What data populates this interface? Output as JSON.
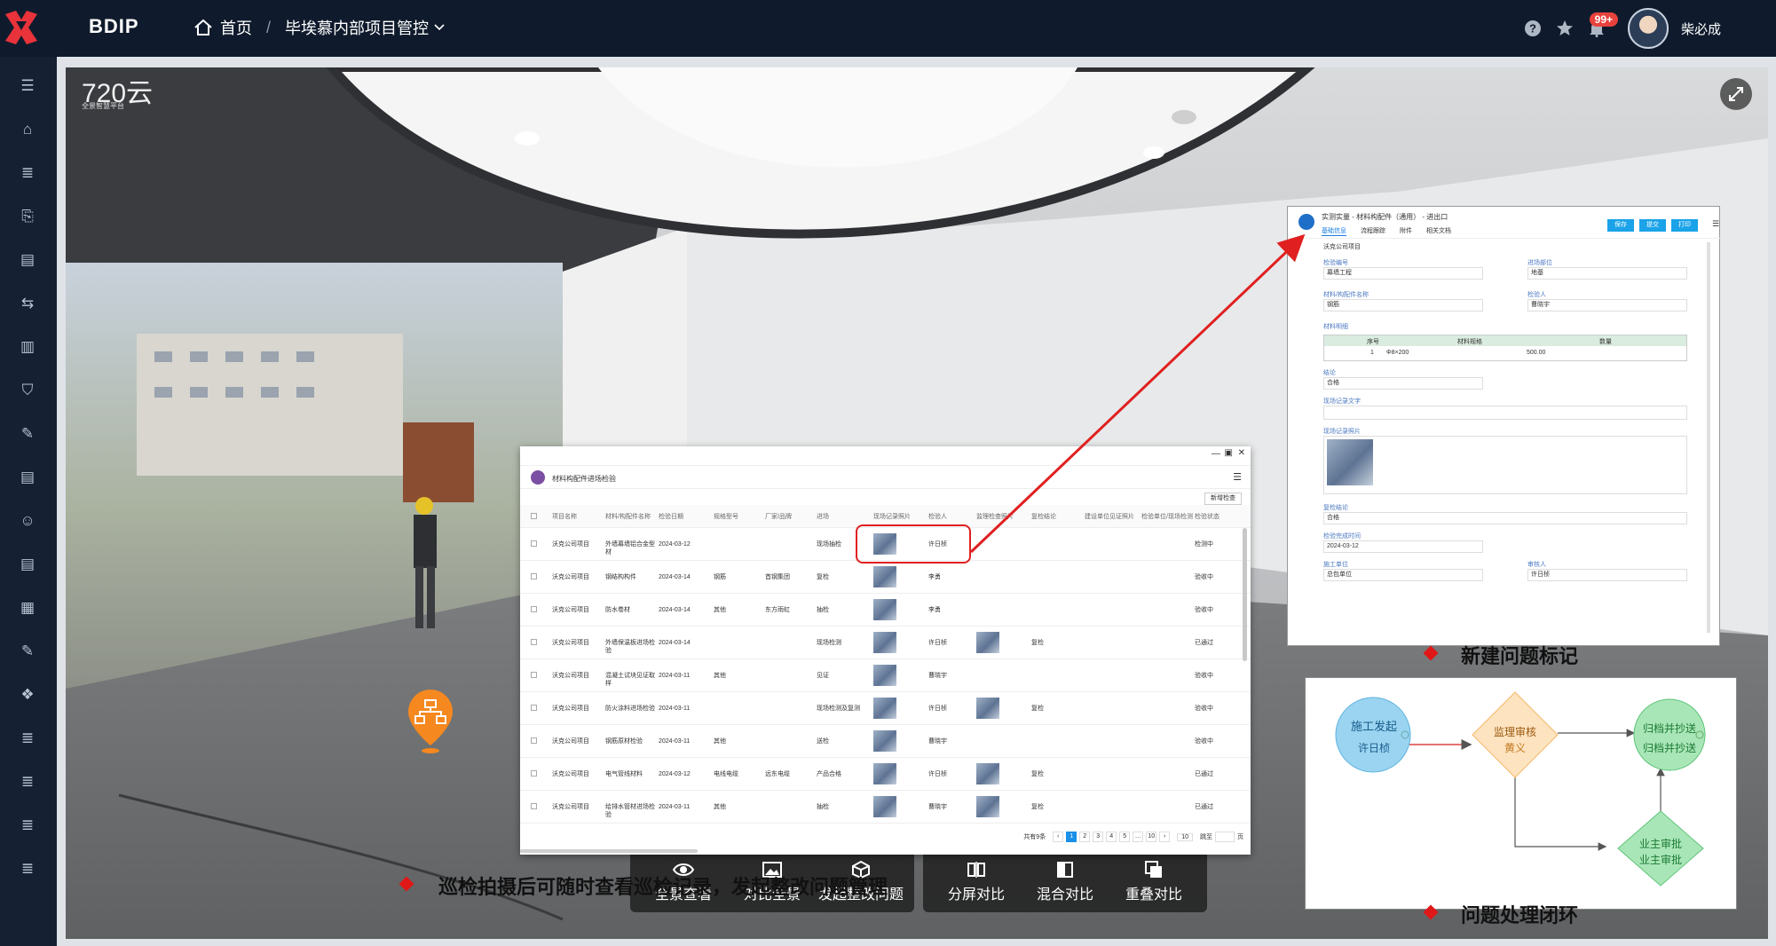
{
  "topbar": {
    "brand": "BDIP",
    "breadcrumb": {
      "home": "首页",
      "separator": "/",
      "project": "毕埃慕内部项目管控"
    },
    "notification_count": "99+",
    "user_name": "柴必成"
  },
  "sidebar": {
    "icons": [
      "menu-icon",
      "home-icon",
      "list-icon",
      "folder-icon",
      "report-icon",
      "sign-icon",
      "building-icon",
      "shield-icon",
      "edit-icon",
      "report-icon",
      "users-icon",
      "report-icon",
      "calendar-icon",
      "edit-icon",
      "cubes-icon",
      "list-icon",
      "list-icon",
      "list-icon",
      "list-icon"
    ]
  },
  "viewer": {
    "watermark": "720云",
    "watermark_sub": "全景智慧平台"
  },
  "toolbar": {
    "left_group": [
      "全景查看",
      "对比全景",
      "发起整改问题"
    ],
    "right_group": [
      "分屏对比",
      "混合对比",
      "重叠对比"
    ]
  },
  "table_panel": {
    "title": "材料构配件进场检验",
    "action_button": "新增检查",
    "columns": [
      "项目名称",
      "材料/构配件名称",
      "检验日期",
      "规格型号",
      "厂家/品牌",
      "进场",
      "现场记录照片",
      "检验人",
      "监理检查照片",
      "复检结论",
      "建设单位见证照片",
      "检验单位/现场检测",
      "检验状态"
    ],
    "rows": [
      {
        "project": "沃克公司项目",
        "name": "外墙幕墙铝合金型材",
        "date": "2024-03-12",
        "spec": "",
        "brand": "",
        "entry": "现场抽检",
        "inspector": "许日桢",
        "recheck": "",
        "status": "检测中"
      },
      {
        "project": "沃克公司项目",
        "name": "钢结构构件",
        "date": "2024-03-14",
        "spec": "钢筋",
        "brand": "首钢集团",
        "entry": "复检",
        "inspector": "李勇",
        "recheck": "",
        "status": "验收中"
      },
      {
        "project": "沃克公司项目",
        "name": "防水卷材",
        "date": "2024-03-14",
        "spec": "其他",
        "brand": "东方雨虹",
        "entry": "抽检",
        "inspector": "李勇",
        "recheck": "",
        "status": "验收中"
      },
      {
        "project": "沃克公司项目",
        "name": "外墙保温板进场检验",
        "date": "2024-03-14",
        "spec": "",
        "brand": "",
        "entry": "现场检测",
        "inspector": "许日桢",
        "recheck": "复检",
        "status": "已通过"
      },
      {
        "project": "沃克公司项目",
        "name": "混凝土试块见证取样",
        "date": "2024-03-11",
        "spec": "其他",
        "brand": "",
        "entry": "见证",
        "inspector": "曹晓宇",
        "recheck": "",
        "status": "验收中"
      },
      {
        "project": "沃克公司项目",
        "name": "防火涂料进场检验",
        "date": "2024-03-11",
        "spec": "",
        "brand": "",
        "entry": "现场检测及复测",
        "inspector": "许日桢",
        "recheck": "复检",
        "status": "验收中"
      },
      {
        "project": "沃克公司项目",
        "name": "钢筋原材检验",
        "date": "2024-03-11",
        "spec": "其他",
        "brand": "",
        "entry": "送检",
        "inspector": "曹晓宇",
        "recheck": "",
        "status": "验收中"
      },
      {
        "project": "沃克公司项目",
        "name": "电气管线材料",
        "date": "2024-03-12",
        "spec": "电线电缆",
        "brand": "远东电缆",
        "entry": "产品合格",
        "inspector": "许日桢",
        "recheck": "复检",
        "status": "已通过"
      },
      {
        "project": "沃克公司项目",
        "name": "给排水管材进场检验",
        "date": "2024-03-11",
        "spec": "其他",
        "brand": "",
        "entry": "抽检",
        "inspector": "曹晓宇",
        "recheck": "复检",
        "status": "已通过"
      }
    ],
    "pagination": {
      "total": "共有9条",
      "pages": [
        "1",
        "2",
        "3",
        "4",
        "5",
        "…",
        "10"
      ],
      "page_size": "10",
      "goto_label": "跳至",
      "page_unit": "页"
    }
  },
  "form_panel": {
    "title": "实测实量 - 材料构配件（通用） - 进出口",
    "tabs": [
      "基础信息",
      "流程跟踪",
      "附件",
      "相关文档"
    ],
    "buttons": [
      "保存",
      "提交",
      "打印"
    ],
    "first_value": "沃克公司项目",
    "fields": [
      {
        "label": "检验编号",
        "value": "幕墙工程"
      },
      {
        "label": "进场部位",
        "value": "地基"
      },
      {
        "label": "材料/构配件名称",
        "value": "钢筋"
      },
      {
        "label": "检验人",
        "value": "曹晓宇"
      }
    ],
    "detail_label": "材料明细",
    "detail_columns": [
      "序号",
      "材料规格",
      "数量"
    ],
    "detail_row": {
      "index": "1",
      "spec": "Φ8×200",
      "qty": "500.00"
    },
    "fields2_label1": "结论",
    "fields2_value1": "合格",
    "fields2_label2": "现场记录文字",
    "photo_label": "现场记录照片",
    "field3_label": "复检结论",
    "field3_value": "合格",
    "date_label": "检验完成时间",
    "date_value": "2024-03-12",
    "unit_label": "施工单位",
    "unit_value": "总包单位",
    "reviewer_label": "审核人",
    "reviewer_value": "许日桢"
  },
  "flow_panel": {
    "start_title": "施工发起",
    "start_person": "许日桢",
    "review_title": "监理审核",
    "review_person": "黄义",
    "archive_title": "归档并抄送",
    "archive_sub": "归档并抄送",
    "owner_title": "业主审批",
    "owner_person": "业主审批"
  },
  "captions": {
    "left": "巡检拍摄后可随时查看巡检记录，发起整改问题管理",
    "new_issue": "新建问题标记",
    "closed_loop": "问题处理闭环"
  },
  "colors": {
    "topbar": "#0f1b2c",
    "sidebar": "#152033",
    "accent": "#1aa3e8",
    "highlight": "#e02020",
    "pin": "#f5881f"
  }
}
